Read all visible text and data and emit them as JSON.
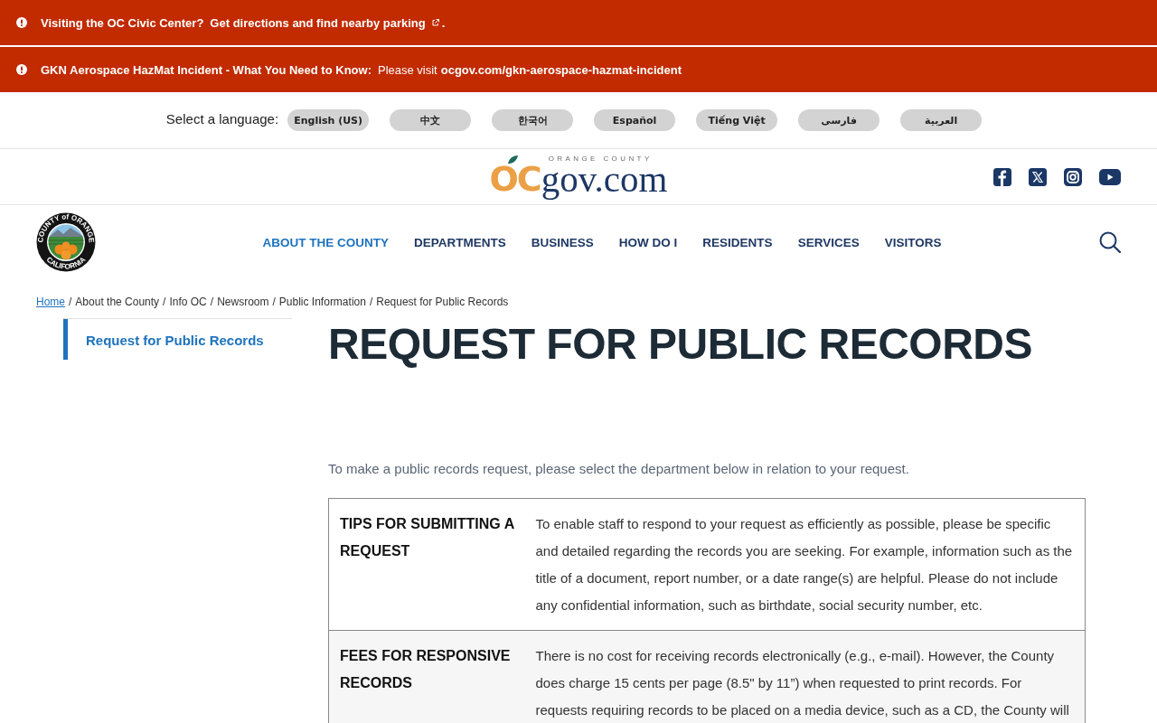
{
  "alerts": [
    {
      "title": "Visiting the OC Civic Center?",
      "link": "Get directions and find nearby parking",
      "external": true,
      "suffix": "."
    },
    {
      "title": "GKN Aerospace HazMat Incident - What You Need to Know:",
      "message": "Please visit",
      "link": "ocgov.com/gkn-aerospace-hazmat-incident",
      "external": false
    }
  ],
  "language_bar": {
    "label": "Select a language:",
    "languages": [
      {
        "label": "English (US)"
      },
      {
        "label": "中文"
      },
      {
        "label": "한국어"
      },
      {
        "label": "Español"
      },
      {
        "label": "Tiếng Việt"
      },
      {
        "label": "فارسی"
      },
      {
        "label": "العربية"
      }
    ]
  },
  "header": {
    "logo": {
      "tagline": "ORANGE COUNTY",
      "prefix": "OC",
      "name": "gov.com"
    }
  },
  "nav": {
    "seal": {
      "top_text": "COUNTY of ORANGE",
      "bottom_text": "CALIFORNIA"
    },
    "items": [
      {
        "label": "ABOUT THE COUNTY",
        "selected": true
      },
      {
        "label": "DEPARTMENTS",
        "selected": false
      },
      {
        "label": "BUSINESS",
        "selected": false
      },
      {
        "label": "HOW DO I",
        "selected": false
      },
      {
        "label": "RESIDENTS",
        "selected": false
      },
      {
        "label": "SERVICES",
        "selected": false
      },
      {
        "label": "VISITORS",
        "selected": false
      }
    ]
  },
  "breadcrumb": {
    "separator": "/",
    "items": [
      {
        "label": "Home",
        "kind": "link"
      },
      {
        "label": "About the County",
        "kind": "text"
      },
      {
        "label": "Info OC",
        "kind": "text"
      },
      {
        "label": "Newsroom",
        "kind": "text"
      },
      {
        "label": "Public Information",
        "kind": "text"
      },
      {
        "label": "Request for Public Records",
        "kind": "text"
      }
    ]
  },
  "sidebar": {
    "items": [
      {
        "label": "Request for Public Records",
        "selected": true
      }
    ]
  },
  "page": {
    "title": "REQUEST FOR PUBLIC RECORDS",
    "intro": "To make a public records request, please select the department below in relation to your request.",
    "table": {
      "rows": [
        {
          "heading": "TIPS FOR SUBMITTING A REQUEST",
          "text": "To enable staff to respond to your request as efficiently as possible, please be specific and detailed regarding the records you are seeking. For example, information such as the title of a document, report number, or a date range(s) are helpful. Please do not include any confidential information, such as birthdate, social security number, etc."
        },
        {
          "heading": "FEES FOR RESPONSIVE RECORDS",
          "text": "There is no cost for receiving records electronically (e.g., e-mail). However, the County does charge 15 cents per page (8.5\" by 11”) when requested to print records. For requests requiring records to be placed on a media device, such as a CD, the County will"
        }
      ]
    }
  }
}
